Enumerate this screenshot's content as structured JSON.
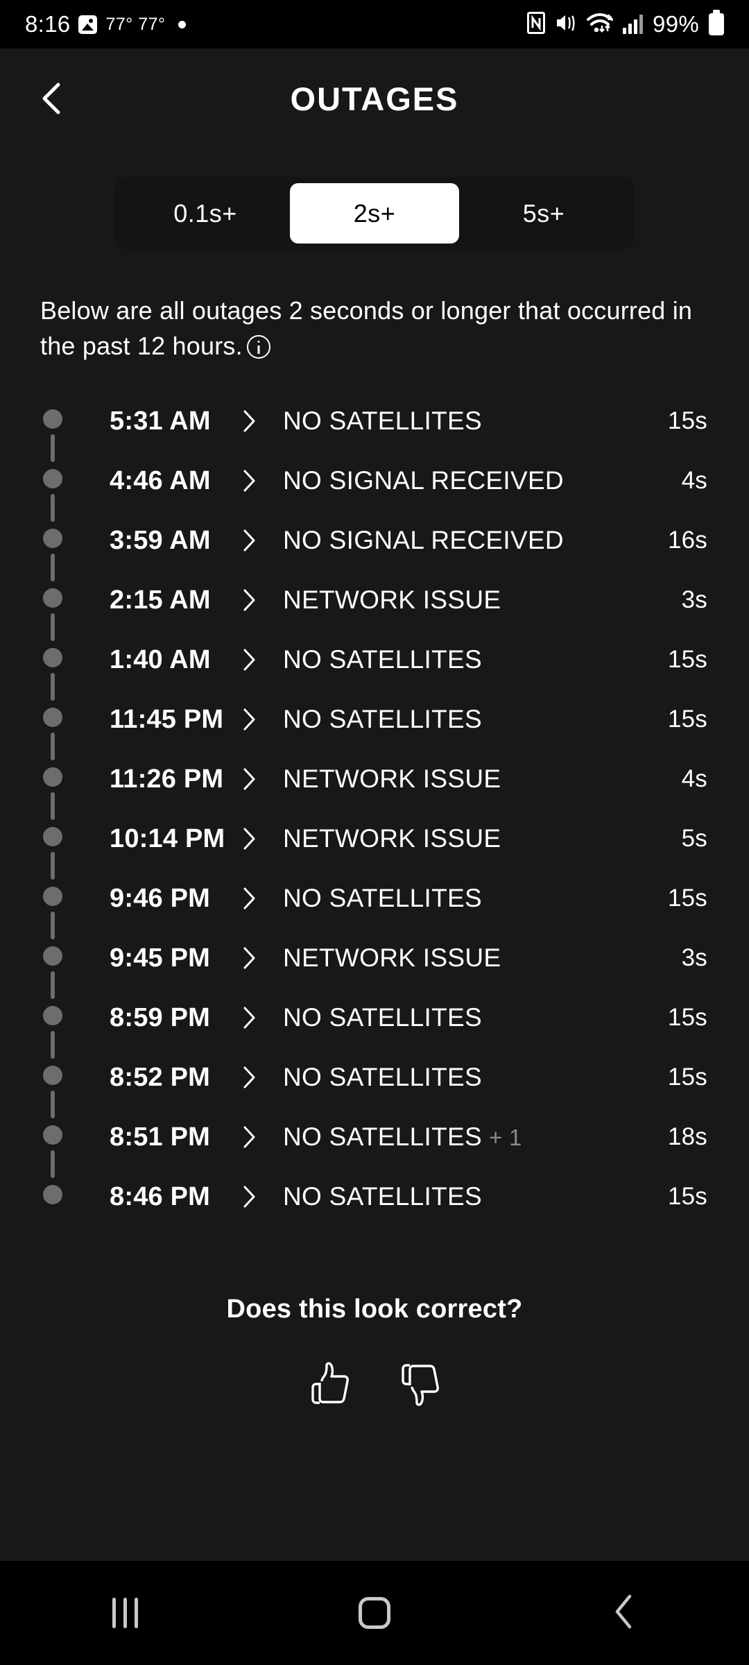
{
  "status_bar": {
    "clock": "8:16",
    "temperatures": "77° 77°",
    "battery_percent": "99%",
    "icons": [
      "photo-icon",
      "notification-dot",
      "nfc-icon",
      "mute-vibrate-icon",
      "wifi-icon",
      "cellular-signal-icon",
      "battery-icon"
    ]
  },
  "header": {
    "title": "OUTAGES",
    "back_icon": "chevron-left-icon"
  },
  "filter": {
    "options": [
      {
        "label": "0.1s+",
        "selected": false
      },
      {
        "label": "2s+",
        "selected": true
      },
      {
        "label": "5s+",
        "selected": false
      }
    ]
  },
  "description": {
    "text": "Below are all outages 2 seconds or longer that occurred in the past 12 hours.",
    "info_icon": "info-icon"
  },
  "outages": [
    {
      "time": "5:31 AM",
      "reason": "NO SATELLITES",
      "extra": "",
      "duration": "15s"
    },
    {
      "time": "4:46 AM",
      "reason": "NO SIGNAL RECEIVED",
      "extra": "",
      "duration": "4s"
    },
    {
      "time": "3:59 AM",
      "reason": "NO SIGNAL RECEIVED",
      "extra": "",
      "duration": "16s"
    },
    {
      "time": "2:15 AM",
      "reason": "NETWORK ISSUE",
      "extra": "",
      "duration": "3s"
    },
    {
      "time": "1:40 AM",
      "reason": "NO SATELLITES",
      "extra": "",
      "duration": "15s"
    },
    {
      "time": "11:45 PM",
      "reason": "NO SATELLITES",
      "extra": "",
      "duration": "15s"
    },
    {
      "time": "11:26 PM",
      "reason": "NETWORK ISSUE",
      "extra": "",
      "duration": "4s"
    },
    {
      "time": "10:14 PM",
      "reason": "NETWORK ISSUE",
      "extra": "",
      "duration": "5s"
    },
    {
      "time": "9:46 PM",
      "reason": "NO SATELLITES",
      "extra": "",
      "duration": "15s"
    },
    {
      "time": "9:45 PM",
      "reason": "NETWORK ISSUE",
      "extra": "",
      "duration": "3s"
    },
    {
      "time": "8:59 PM",
      "reason": "NO SATELLITES",
      "extra": "",
      "duration": "15s"
    },
    {
      "time": "8:52 PM",
      "reason": "NO SATELLITES",
      "extra": "",
      "duration": "15s"
    },
    {
      "time": "8:51 PM",
      "reason": "NO SATELLITES",
      "extra": "+ 1",
      "duration": "18s"
    },
    {
      "time": "8:46 PM",
      "reason": "NO SATELLITES",
      "extra": "",
      "duration": "15s"
    }
  ],
  "feedback": {
    "question": "Does this look correct?",
    "thumbs_up_icon": "thumbs-up-icon",
    "thumbs_down_icon": "thumbs-down-icon"
  },
  "nav_bar": {
    "recents_icon": "recents-icon",
    "home_icon": "home-icon",
    "back_icon": "back-chevron-icon"
  },
  "colors": {
    "app_background": "#181818",
    "system_background": "#000000",
    "accent_selected": "#ffffff",
    "timeline": "#6d6d6d",
    "muted_text": "#8a8a8a"
  }
}
